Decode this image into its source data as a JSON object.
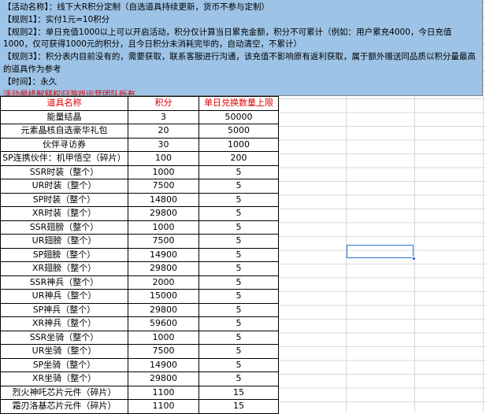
{
  "notice": {
    "activity_name": "【活动名称】：线下大R积分定制（自选道具持续更新，货币不参与定制）",
    "rule1": "【规则1】：实付1元=10积分",
    "rule2": "【规则2】：单日充值1000以上可以开启活动，积分仅计算当日累充金额，积分不可累计（例如：用户累充4000，今日充值1000，仅可获得1000元的积分，且今日积分未消耗完毕的，自动清空，不累计）",
    "rule3": "【规则3】：积分表内目前没有的，需要获取，联系客服进行沟通，该充值不影响原有返利获取，属于额外赠送同品质以积分量最高的道具作为参考",
    "time": "【时间】：永久",
    "disclaimer": "活动最终解释权归游戏运营团队所有"
  },
  "table": {
    "headers": [
      "道具名称",
      "积分",
      "单日兑换数量上限"
    ],
    "rows": [
      [
        "能量结晶",
        "3",
        "50000"
      ],
      [
        "元素晶核自选豪华礼包",
        "20",
        "5000"
      ],
      [
        "伙伴寻访券",
        "30",
        "1000"
      ],
      [
        "SP连携伙伴：机甲悟空（碎片）",
        "100",
        "200"
      ],
      [
        "SSR时装（整个）",
        "1000",
        "5"
      ],
      [
        "UR时装（整个）",
        "7500",
        "5"
      ],
      [
        "SP时装（整个）",
        "14800",
        "5"
      ],
      [
        "XR时装（整个）",
        "29800",
        "5"
      ],
      [
        "SSR翅膀（整个）",
        "1000",
        "5"
      ],
      [
        "UR翅膀（整个）",
        "7500",
        "5"
      ],
      [
        "SP翅膀（整个）",
        "14900",
        "5"
      ],
      [
        "XR翅膀（整个）",
        "29800",
        "5"
      ],
      [
        "SSR神兵（整个）",
        "2000",
        "5"
      ],
      [
        "UR神兵（整个）",
        "15000",
        "5"
      ],
      [
        "SP神兵（整个）",
        "29800",
        "5"
      ],
      [
        "XR神兵（整个）",
        "59600",
        "5"
      ],
      [
        "SSR坐骑（整个）",
        "1000",
        "5"
      ],
      [
        "UR坐骑（整个）",
        "7500",
        "5"
      ],
      [
        "SP坐骑（整个）",
        "14900",
        "5"
      ],
      [
        "XR坐骑（整个）",
        "29800",
        "5"
      ],
      [
        "烈火神吒芯片元件（碎片）",
        "1100",
        "15"
      ],
      [
        "霜刃洛基芯片元件（碎片）",
        "1100",
        "15"
      ]
    ]
  },
  "colors": {
    "notice_bg": "#9dc3e6",
    "header_text": "#e00000",
    "selection": "#2f6fd6"
  }
}
